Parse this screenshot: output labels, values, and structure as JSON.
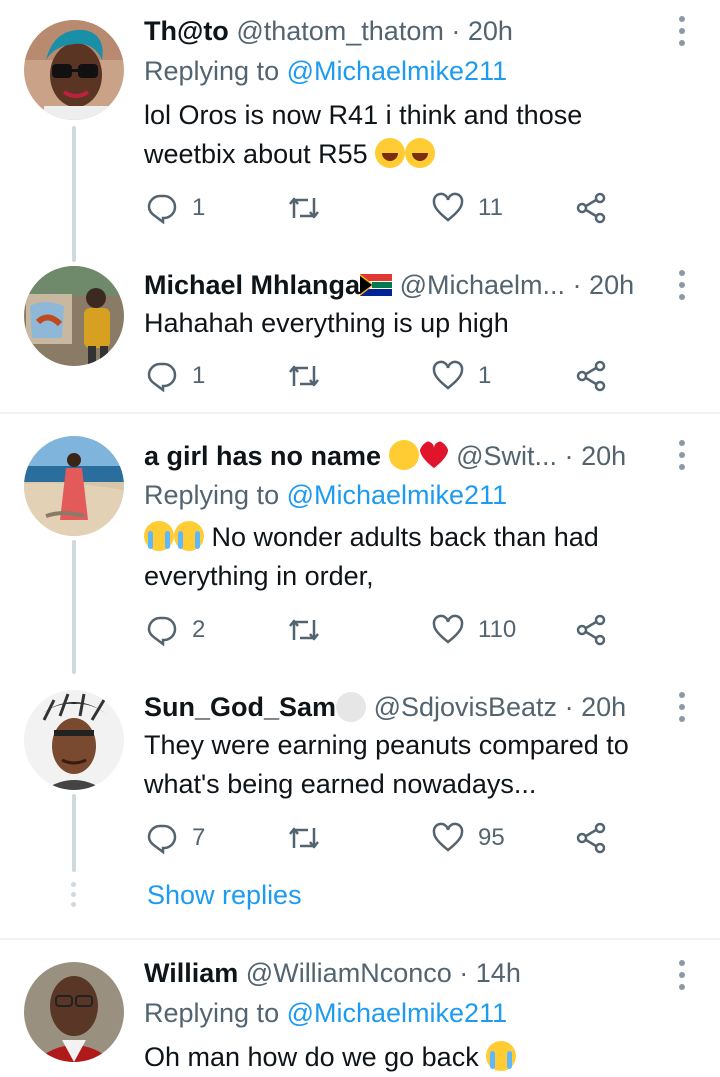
{
  "tweets": [
    {
      "name": "Th@to",
      "handle": "@thatom_thatom",
      "time": "20h",
      "replying_label": "Replying to",
      "replying_to": "@Michaelmike211",
      "text_line1": "lol Oros is now R41 i think and those",
      "text_line2": "weetbix about R55",
      "replies": "1",
      "retweets": "",
      "likes": "11"
    },
    {
      "name": "Michael Mhlanga",
      "handle": "@Michaelm...",
      "time": "20h",
      "text_line1": "Hahahah everything is up high",
      "replies": "1",
      "retweets": "",
      "likes": "1"
    },
    {
      "name": "a girl has no name",
      "handle": "@Swit...",
      "time": "20h",
      "replying_label": "Replying to",
      "replying_to": "@Michaelmike211",
      "text_line1": "No wonder adults back than had",
      "text_line2": "everything in order,",
      "replies": "2",
      "retweets": "",
      "likes": "110"
    },
    {
      "name": "Sun_God_Sam",
      "handle": "@SdjovisBeatz",
      "time": "20h",
      "text_line1": "They were earning peanuts compared to",
      "text_line2": "what's being earned nowadays...",
      "replies": "7",
      "retweets": "",
      "likes": "95"
    },
    {
      "name": "William",
      "handle": "@WilliamNconco",
      "time": "14h",
      "replying_label": "Replying to",
      "replying_to": "@Michaelmike211",
      "text_line1": "Oh man how do we go back"
    }
  ],
  "separator": "·",
  "show_replies": "Show replies",
  "icons": {
    "reply": "reply-icon",
    "retweet": "retweet-icon",
    "like": "heart-icon",
    "share": "share-icon",
    "more": "more-vertical-icon"
  },
  "colors": {
    "link": "#1d9bf0",
    "secondary": "#536471",
    "thread_line": "#cfd9de"
  }
}
